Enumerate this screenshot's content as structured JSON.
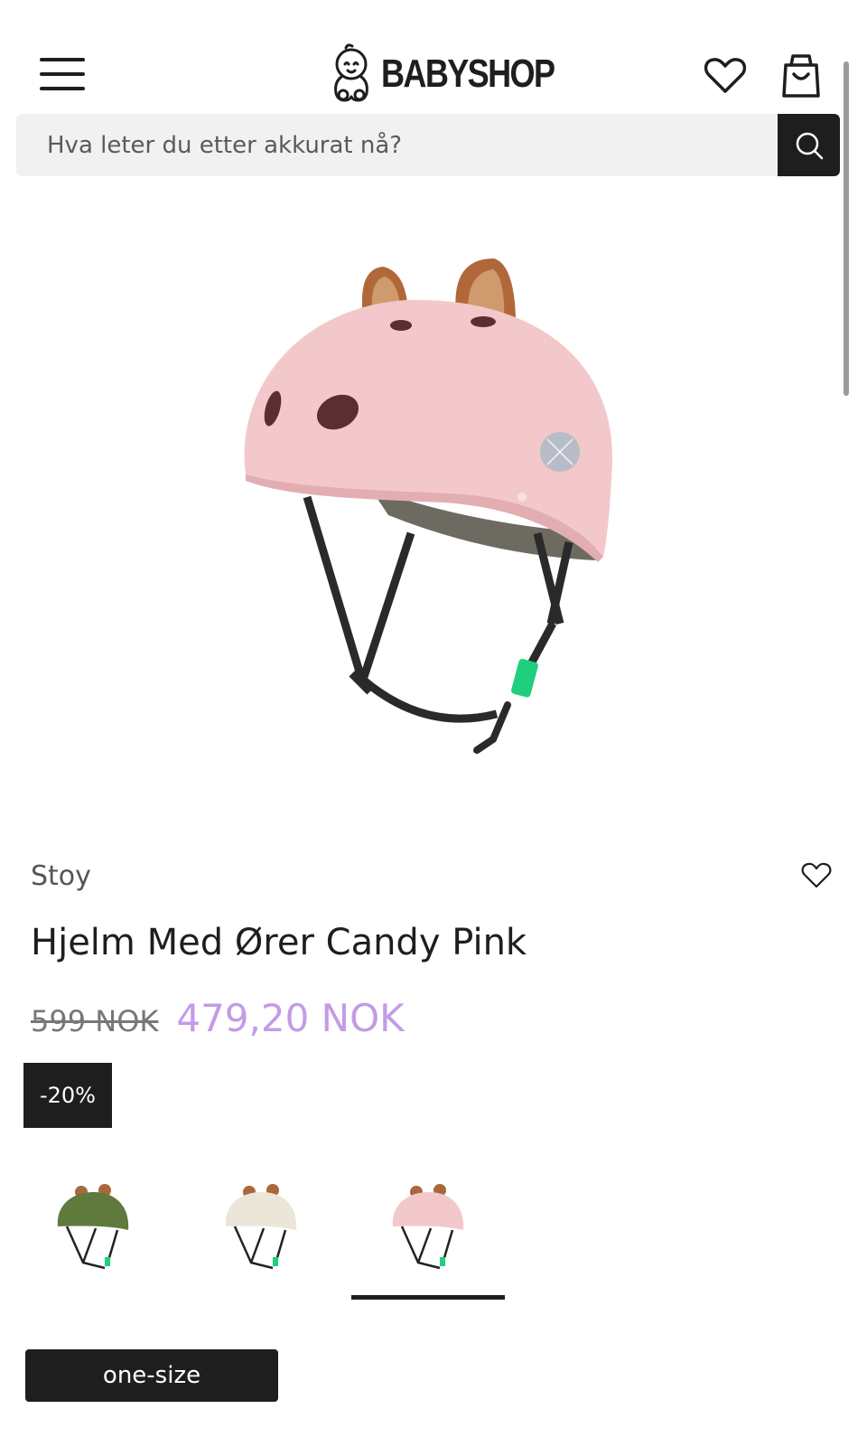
{
  "header": {
    "logo_text": "BABYSHOP",
    "menu_icon": "hamburger-menu-icon",
    "wishlist_icon": "heart-icon",
    "cart_icon": "shopping-bag-icon"
  },
  "search": {
    "placeholder": "Hva leter du etter akkurat nå?",
    "icon": "search-icon"
  },
  "product": {
    "brand": "Stoy",
    "title": "Hjelm Med Ører Candy Pink",
    "old_price": "599 NOK",
    "new_price": "479,20 NOK",
    "discount_badge": "-20%",
    "selected_color": "Candy Pink",
    "variants": [
      {
        "color_name": "green",
        "shell": "#5f7a3c"
      },
      {
        "color_name": "cream",
        "shell": "#ebe6d8"
      },
      {
        "color_name": "pink",
        "shell": "#f3c8cb"
      }
    ],
    "size_label": "one-size"
  },
  "colors": {
    "accent_price": "#c39be6",
    "dark": "#1e1e1e",
    "helmet_pink": "#f3c8cb",
    "ear_brown": "#b0683a",
    "buckle_green": "#1fcf7d"
  }
}
